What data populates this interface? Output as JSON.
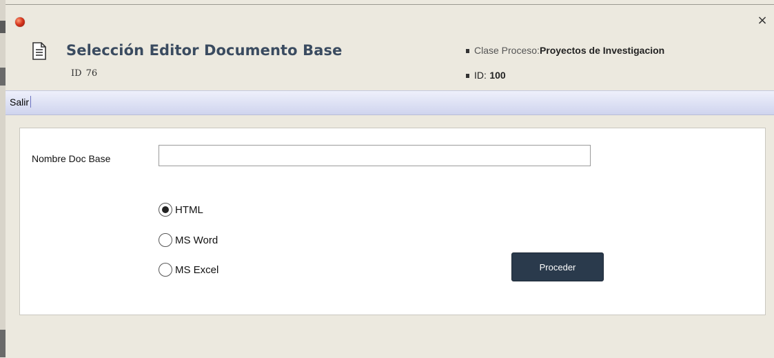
{
  "window": {
    "close_glyph": "×"
  },
  "header": {
    "title": "Selección Editor Documento Base",
    "id_label": "ID",
    "id_value": "76",
    "icon": "document-icon",
    "meta": {
      "clase_label": "Clase Proceso:",
      "clase_value": "Proyectos de Investigacion",
      "id_label": "ID:",
      "id_value": "100"
    }
  },
  "toolbar": {
    "salir_label": "Salir"
  },
  "form": {
    "nombre_label": "Nombre Doc Base",
    "nombre_value": "",
    "nombre_placeholder": "",
    "options": [
      {
        "label": "HTML",
        "checked": true
      },
      {
        "label": "MS Word",
        "checked": false
      },
      {
        "label": "MS Excel",
        "checked": false
      }
    ],
    "proceed_label": "Proceder"
  },
  "colors": {
    "title": "#3a4b60",
    "button": "#2a3a4c",
    "toolbar_top": "#eef0fb",
    "toolbar_bottom": "#cfd4ee",
    "background": "#ece9df",
    "app_dot": "#d7371f"
  }
}
